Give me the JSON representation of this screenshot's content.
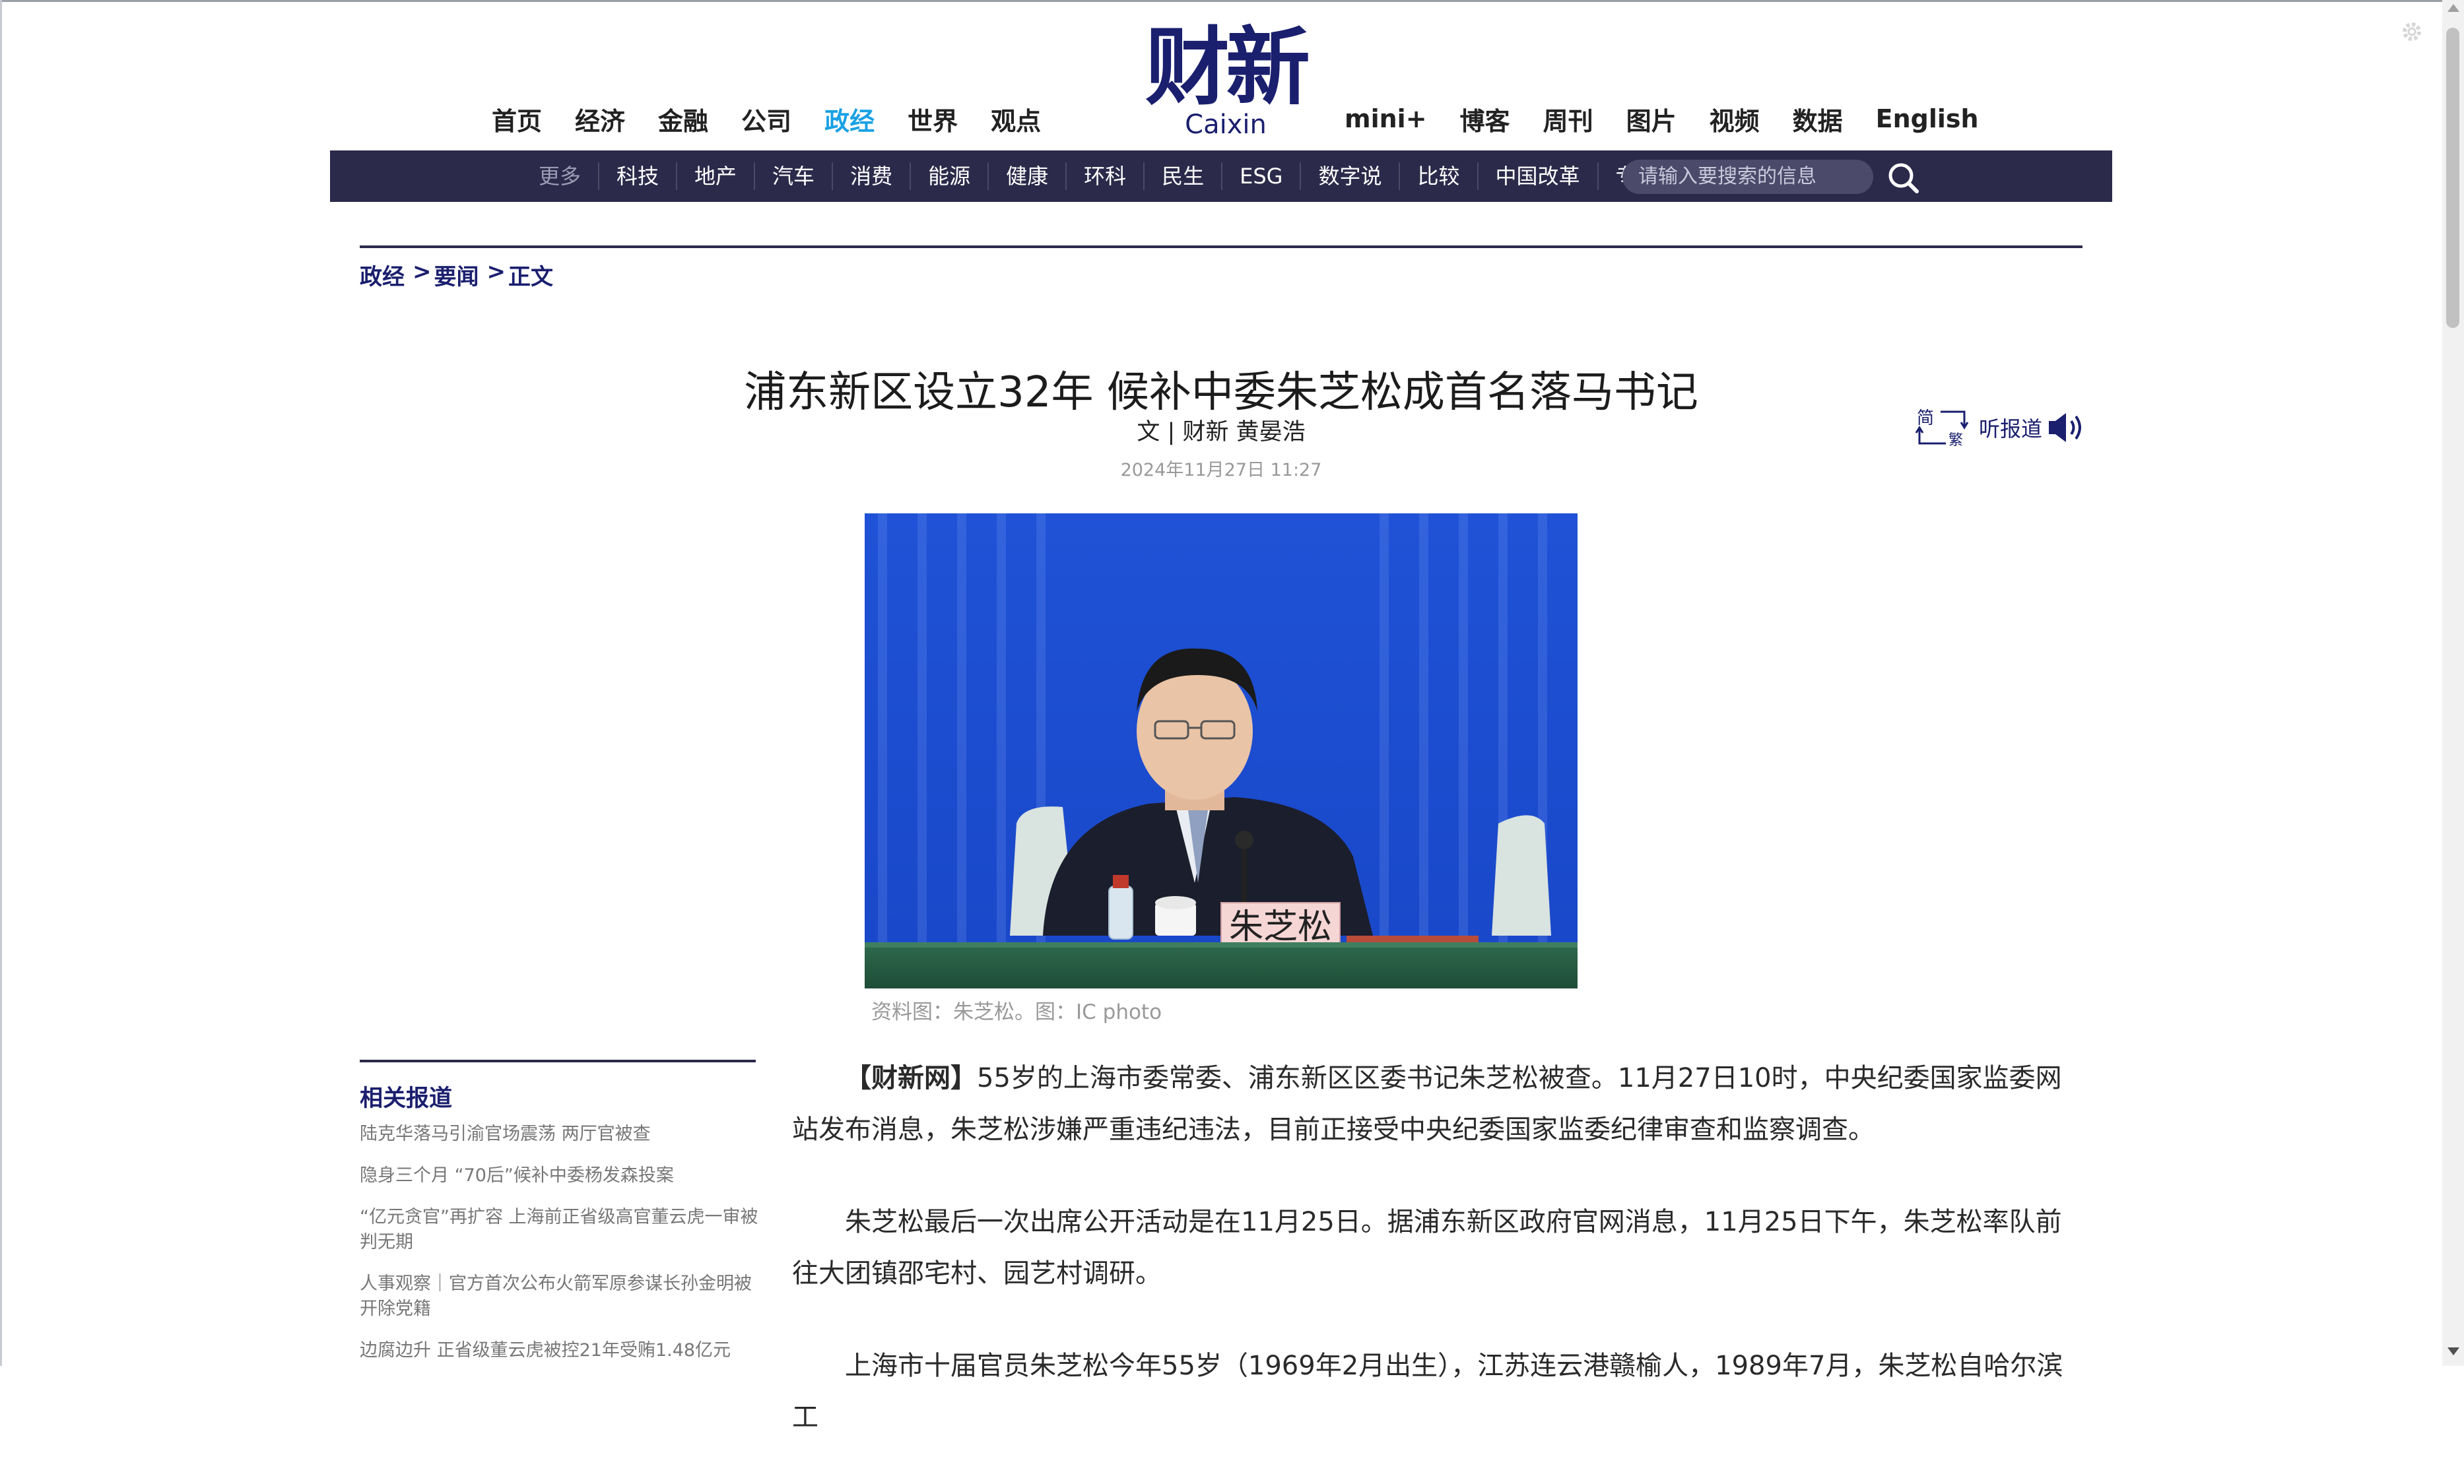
{
  "top_nav": {
    "left": [
      {
        "label": "首页"
      },
      {
        "label": "经济"
      },
      {
        "label": "金融"
      },
      {
        "label": "公司"
      },
      {
        "label": "政经",
        "active": true
      },
      {
        "label": "世界"
      },
      {
        "label": "观点"
      }
    ],
    "right": [
      {
        "label": "mini+"
      },
      {
        "label": "博客"
      },
      {
        "label": "周刊"
      },
      {
        "label": "图片"
      },
      {
        "label": "视频"
      },
      {
        "label": "数据"
      },
      {
        "label": "English"
      }
    ],
    "active_color": "#1aa1e3"
  },
  "logo": {
    "cn": "财新",
    "en": "Caixin",
    "color": "#1a1f6e"
  },
  "sub_nav": {
    "more": "更多",
    "items": [
      "科技",
      "地产",
      "汽车",
      "消费",
      "能源",
      "健康",
      "环科",
      "民生",
      "ESG",
      "数字说",
      "比较",
      "中国改革",
      "专题"
    ],
    "bg_color": "#2b2a4a"
  },
  "search": {
    "placeholder": "请输入要搜索的信息"
  },
  "breadcrumb": {
    "items": [
      "政经",
      "要闻",
      "正文"
    ],
    "sep": ">"
  },
  "article": {
    "title": "浦东新区设立32年 候补中委朱芝松成首名落马书记",
    "byline": "文 | 财新 黄晏浩",
    "date": "2024年11月27日 11:27",
    "listen_label": "听报道",
    "simptrad": {
      "simp": "简",
      "trad": "繁"
    },
    "photo_caption": "资料图：朱芝松。图：IC photo",
    "nameplate": "朱芝松",
    "lead_tag": "【财新网】",
    "paragraphs": [
      "55岁的上海市委常委、浦东新区区委书记朱芝松被查。11月27日10时，中央纪委国家监委网站发布消息，朱芝松涉嫌严重违纪违法，目前正接受中央纪委国家监委纪律审查和监察调查。",
      "朱芝松最后一次出席公开活动是在11月25日。据浦东新区政府官网消息，11月25日下午，朱芝松率队前往大团镇邵宅村、园艺村调研。",
      "上海市十届官员朱芝松今年55岁（1969年2月出生），江苏连云港赣榆人，1989年7月，朱芝松自哈尔滨工"
    ]
  },
  "sidebar": {
    "title": "相关报道",
    "items": [
      "陆克华落马引渝官场震荡 两厅官被查",
      "隐身三个月 “70后”候补中委杨发森投案",
      "“亿元贪官”再扩容 上海前正省级高官董云虎一审被判无期",
      "人事观察｜官方首次公布火箭军原参谋长孙金明被开除党籍",
      "边腐边升 正省级董云虎被控21年受贿1.48亿元"
    ]
  }
}
